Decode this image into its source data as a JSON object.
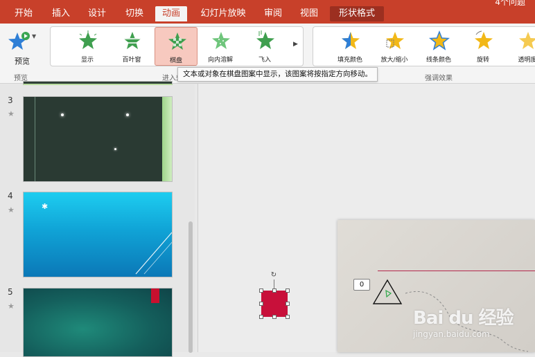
{
  "ribbon_tabs": [
    {
      "label": "开始"
    },
    {
      "label": "插入"
    },
    {
      "label": "设计"
    },
    {
      "label": "切换"
    },
    {
      "label": "动画"
    },
    {
      "label": "幻灯片放映"
    },
    {
      "label": "审阅"
    },
    {
      "label": "视图"
    },
    {
      "label": "形状格式"
    }
  ],
  "top_right_text": "4个问题",
  "preview": {
    "label": "预览",
    "group_label": "预览"
  },
  "entrance_effects": {
    "group_label": "进入效果",
    "items": [
      {
        "label": "显示",
        "color": "#3f9f4f"
      },
      {
        "label": "百叶窗",
        "color": "#3f9f4f"
      },
      {
        "label": "棋盘",
        "color": "#3f9f4f"
      },
      {
        "label": "向内溶解",
        "color": "#5fbf6f"
      },
      {
        "label": "飞入",
        "color": "#3f9f4f"
      }
    ]
  },
  "emphasis_effects": {
    "group_label": "强调效果",
    "items": [
      {
        "label": "填充颜色",
        "color": "#f2b817"
      },
      {
        "label": "放大/缩小",
        "color": "#f2b817"
      },
      {
        "label": "线条颜色",
        "color": "#f2b817"
      },
      {
        "label": "旋转",
        "color": "#f2b817"
      },
      {
        "label": "透明度",
        "color": "#f2b817"
      }
    ]
  },
  "tooltip": "文本或对象在棋盘图案中显示，该图案将按指定方向移动。",
  "slides": [
    {
      "number": "3",
      "star": "★"
    },
    {
      "number": "4",
      "star": "★"
    },
    {
      "number": "5",
      "star": "★"
    }
  ],
  "canvas": {
    "animation_order_badge": "0",
    "selected_shape_color": "#c8103a"
  },
  "watermark": {
    "brand": "Bai du 经验",
    "sub": "jingyan.baidu.com"
  },
  "colors": {
    "accent": "#c8402a",
    "active_tab_bg": "#f4f4f4",
    "selected_effect_bg": "#f7c9bf"
  }
}
